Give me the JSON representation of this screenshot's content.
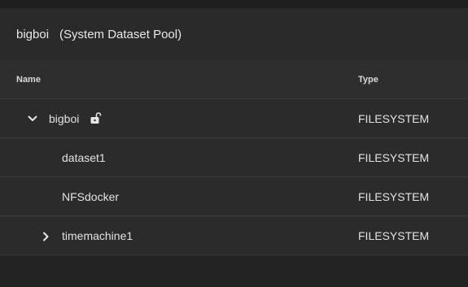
{
  "header": {
    "pool_name": "bigboi",
    "pool_subtitle": "(System Dataset Pool)"
  },
  "table": {
    "columns": {
      "name": "Name",
      "type": "Type"
    },
    "rows": [
      {
        "name": "bigboi",
        "type": "FILESYSTEM",
        "expander": "chevron-down-icon",
        "icon": "unlocked-padlock-icon"
      },
      {
        "name": "dataset1",
        "type": "FILESYSTEM"
      },
      {
        "name": "NFSdocker",
        "type": "FILESYSTEM"
      },
      {
        "name": "timemachine1",
        "type": "FILESYSTEM",
        "expander": "chevron-right-icon"
      }
    ]
  },
  "colors": {
    "background": "#232323",
    "header_bg": "#2a2a2a",
    "row_bg": "#2b2b2b",
    "divider": "#3a3a3a",
    "text": "#e2e2e2"
  }
}
